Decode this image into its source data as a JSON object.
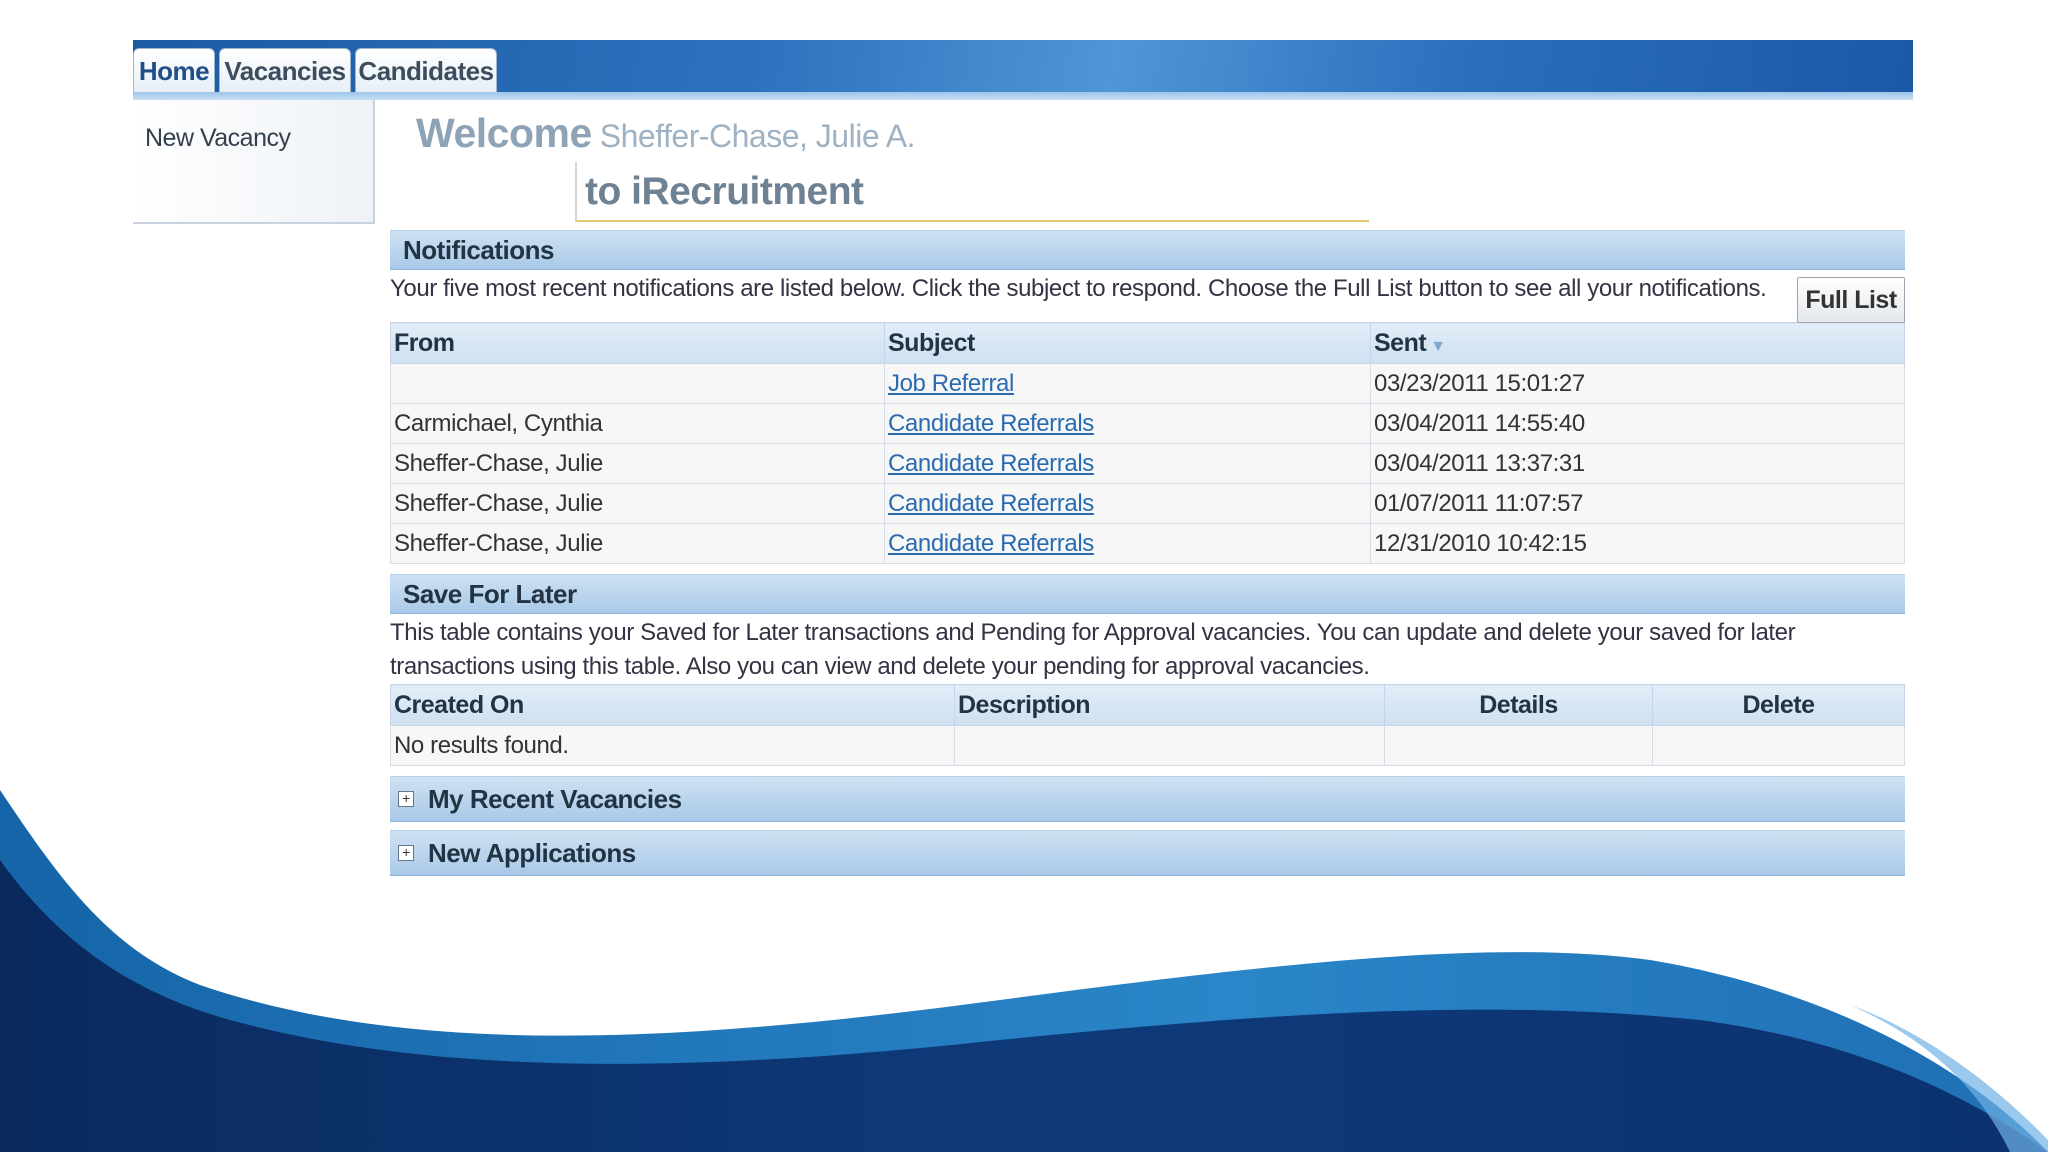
{
  "tabs": [
    {
      "label": "Home",
      "active": true
    },
    {
      "label": "Vacancies",
      "active": false
    },
    {
      "label": "Candidates",
      "active": false
    }
  ],
  "sidebar": {
    "items": [
      {
        "label": "New Vacancy"
      }
    ]
  },
  "welcome": {
    "prefix": "Welcome",
    "user_name": "Sheffer-Chase, Julie A.",
    "subtitle": "to iRecruitment"
  },
  "notifications": {
    "title": "Notifications",
    "description": "Your five most recent notifications are listed below. Click the subject to respond. Choose the Full List button to see all your notifications.",
    "full_list_label": "Full List",
    "columns": {
      "from": "From",
      "subject": "Subject",
      "sent": "Sent"
    },
    "sort_icon": "sort-descending-icon",
    "rows": [
      {
        "from": "",
        "subject": "Job Referral",
        "sent": "03/23/2011 15:01:27"
      },
      {
        "from": "Carmichael, Cynthia",
        "subject": "Candidate Referrals",
        "sent": "03/04/2011 14:55:40"
      },
      {
        "from": "Sheffer-Chase, Julie",
        "subject": "Candidate Referrals",
        "sent": "03/04/2011 13:37:31"
      },
      {
        "from": "Sheffer-Chase, Julie",
        "subject": "Candidate Referrals",
        "sent": "01/07/2011 11:07:57"
      },
      {
        "from": "Sheffer-Chase, Julie",
        "subject": "Candidate Referrals",
        "sent": "12/31/2010 10:42:15"
      }
    ]
  },
  "save_for_later": {
    "title": "Save For Later",
    "description": "This table contains your Saved for Later transactions and Pending for Approval vacancies. You can update and delete your saved for later transactions using this table. Also you can view and delete your pending for approval vacancies.",
    "columns": {
      "created_on": "Created On",
      "description": "Description",
      "details": "Details",
      "delete": "Delete"
    },
    "empty_text": "No results found."
  },
  "collapsed_sections": [
    {
      "title": "My Recent Vacancies",
      "icon": "expand-plus-icon"
    },
    {
      "title": "New Applications",
      "icon": "expand-plus-icon"
    }
  ],
  "colors": {
    "tabbar": "#2c72bd",
    "section_header": "#b8d3ed",
    "link": "#2a6bb0",
    "wave_dark": "#0c2f63",
    "wave_mid": "#1f74b6"
  }
}
